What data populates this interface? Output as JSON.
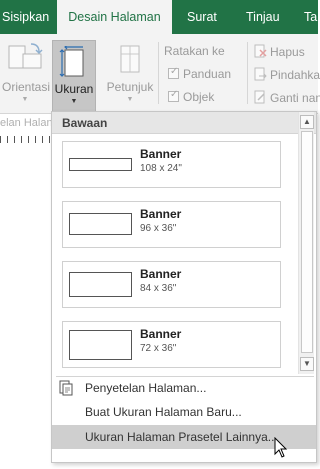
{
  "tabs": [
    {
      "label": "Sisipkan"
    },
    {
      "label": "Desain Halaman"
    },
    {
      "label": "Surat"
    },
    {
      "label": "Tinjau"
    },
    {
      "label": "Ta"
    }
  ],
  "ribbon": {
    "orientasi": "Orientasi",
    "ukuran": "Ukuran",
    "petunjuk": "Petunjuk",
    "ratakan_ke": "Ratakan ke",
    "panduan": "Panduan",
    "objek": "Objek",
    "hapus": "Hapus",
    "pindahkan": "Pindahka",
    "ganti_nama": "Ganti nan",
    "ruler_label": "elan Halan"
  },
  "menu": {
    "header": "Bawaan",
    "presets": [
      {
        "name": "Banner",
        "size": "108 x 24\""
      },
      {
        "name": "Banner",
        "size": "96 x 36\""
      },
      {
        "name": "Banner",
        "size": "84 x 36\""
      },
      {
        "name": "Banner",
        "size": "72 x 36\""
      }
    ],
    "items": [
      {
        "label": "Penyetelan Halaman..."
      },
      {
        "label": "Buat Ukuran Halaman Baru..."
      },
      {
        "label": "Ukuran Halaman Prasetel Lainnya..."
      }
    ]
  },
  "colors": {
    "accent": "#217346",
    "ribbon": "#f3f3f3",
    "hover": "#cfcfcf"
  }
}
